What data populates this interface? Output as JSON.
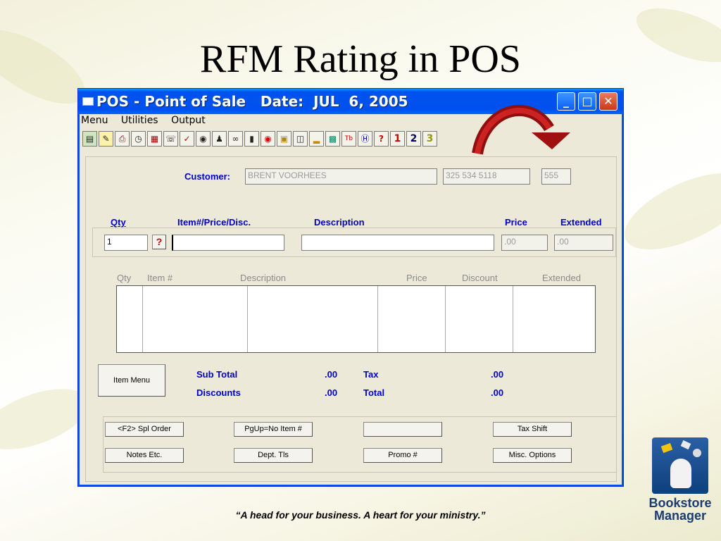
{
  "slide": {
    "title": "RFM Rating in POS",
    "tagline": "“A head for your business. A heart for your ministry.”",
    "brand_line1": "Bookstore",
    "brand_line2": "Manager"
  },
  "window": {
    "title": "POS - Point of Sale   Date:  JUL  6, 2005",
    "minimize_glyph": "_",
    "maximize_glyph": "□",
    "close_glyph": "✕"
  },
  "menu": {
    "items": [
      "Menu",
      "Utilities",
      "Output"
    ]
  },
  "toolbar": {
    "help_glyph": "?",
    "btn1": "1",
    "btn2": "2",
    "btn3": "3"
  },
  "customer": {
    "label": "Customer:",
    "name": "BRENT VOORHEES",
    "phone": "325 534 5118",
    "code": "555"
  },
  "entry": {
    "qty_label": "Qty",
    "item_label": "Item#/Price/Disc.",
    "desc_label": "Description",
    "price_label": "Price",
    "extended_label": "Extended",
    "qty_value": "1",
    "lookup_glyph": "?",
    "item_value": "",
    "desc_value": "",
    "price_value": ".00",
    "extended_value": ".00"
  },
  "grid": {
    "headers": [
      "Qty",
      "Item #",
      "Description",
      "Price",
      "Discount",
      "Extended"
    ]
  },
  "totals": {
    "item_menu": "Item Menu",
    "subtotal_label": "Sub Total",
    "subtotal_value": ".00",
    "discounts_label": "Discounts",
    "discounts_value": ".00",
    "tax_label": "Tax",
    "tax_value": ".00",
    "total_label": "Total",
    "total_value": ".00"
  },
  "buttons": {
    "spl_order": "<F2> Spl Order",
    "no_item": "PgUp=No Item #",
    "blank": "",
    "tax_shift": "Tax Shift",
    "notes": "Notes Etc.",
    "dept_tls": "Dept. Tls",
    "promo": "Promo #",
    "misc_options": "Misc. Options"
  },
  "colors": {
    "accent_blue": "#0000cc",
    "arrow_red": "#a01010",
    "titlebar_blue": "#0050ee"
  },
  "icons": [
    "keyboard-icon",
    "note-icon",
    "printer-icon",
    "clock-icon",
    "calculator-icon",
    "phone-icon",
    "stamp-icon",
    "binoculars-icon",
    "people-icon",
    "glasses-icon",
    "barcode-icon",
    "target-icon",
    "lock-icon",
    "form-icon",
    "chart-icon",
    "screen-icon",
    "tb-icon",
    "h-icon"
  ]
}
